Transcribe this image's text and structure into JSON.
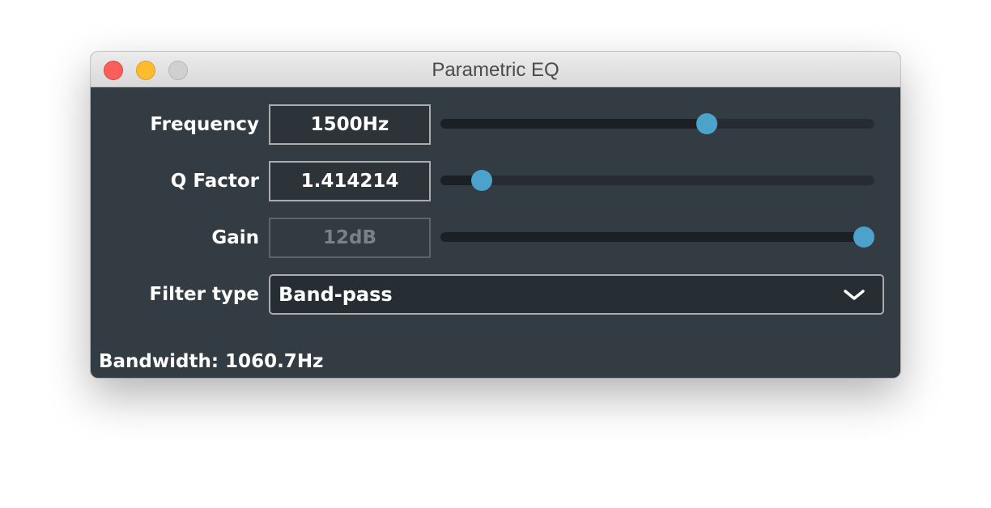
{
  "window": {
    "title": "Parametric EQ"
  },
  "controls": [
    {
      "label": "Frequency",
      "value": "1500Hz",
      "slider_fraction": 0.62,
      "enabled": true
    },
    {
      "label": "Q Factor",
      "value": "1.414214",
      "slider_fraction": 0.075,
      "enabled": true
    },
    {
      "label": "Gain",
      "value": "12dB",
      "slider_fraction": 1.0,
      "enabled": false
    }
  ],
  "filter": {
    "label": "Filter type",
    "selected": "Band-pass"
  },
  "status": {
    "bandwidth": "Bandwidth: 1060.7Hz"
  },
  "colors": {
    "panel_background": "#343c43",
    "slider_thumb": "#4ba3cc",
    "close_button": "#fc5f57",
    "minimize_button": "#fdbc2e",
    "zoom_button": "#d0d0d0"
  },
  "icons": {
    "dropdown": "chevron-down-icon"
  }
}
